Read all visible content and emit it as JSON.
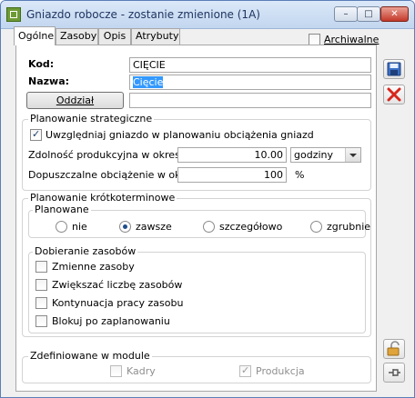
{
  "window": {
    "title": "Gniazdo robocze - zostanie zmienione  (1A)"
  },
  "titlebar_buttons": {
    "minimize": "–",
    "maximize": "□",
    "close": "✕"
  },
  "tabs": [
    {
      "label": "Ogólne",
      "active": true
    },
    {
      "label": "Zasoby",
      "active": false
    },
    {
      "label": "Opis",
      "active": false
    },
    {
      "label": "Atrybuty",
      "active": false
    }
  ],
  "archiwalne": {
    "label": "Archiwalne",
    "checked": false
  },
  "fields": {
    "kod": {
      "label": "Kod:",
      "value": "CIĘCIE"
    },
    "nazwa": {
      "label": "Nazwa:",
      "value": "Cięcie"
    },
    "oddzial": {
      "button": "Oddział",
      "value": ""
    }
  },
  "strategiczne": {
    "title": "Planowanie strategiczne",
    "uwzgledniaj": {
      "label": "Uwzględniaj gniazdo w planowaniu obciążenia gniazd",
      "checked": true
    },
    "zdolnosc": {
      "label": "Zdolność produkcyjna w okresie:",
      "value": "10.00",
      "unit": "godziny"
    },
    "dopuszczalne": {
      "label": "Dopuszczalne obciążenie w okresie:",
      "value": "100",
      "unit": "%"
    }
  },
  "krotkoterminowe": {
    "title": "Planowanie krótkoterminowe",
    "planowane": {
      "title": "Planowane",
      "options": [
        "nie",
        "zawsze",
        "szczegółowo",
        "zgrubnie"
      ],
      "selected": "zawsze"
    },
    "dobieranie": {
      "title": "Dobieranie zasobów",
      "items": [
        {
          "label": "Zmienne zasoby",
          "checked": false
        },
        {
          "label": "Zwiększać liczbę zasobów",
          "checked": false
        },
        {
          "label": "Kontynuacja pracy zasobu",
          "checked": false
        },
        {
          "label": "Blokuj po zaplanowaniu",
          "checked": false
        }
      ]
    }
  },
  "modul": {
    "title": "Zdefiniowane w module",
    "kadry": {
      "label": "Kadry",
      "checked": false
    },
    "produkcja": {
      "label": "Produkcja",
      "checked": true
    }
  },
  "colors": {
    "save": "#3a6fc4",
    "delete": "#d8261b",
    "selection": "#3399ff"
  }
}
